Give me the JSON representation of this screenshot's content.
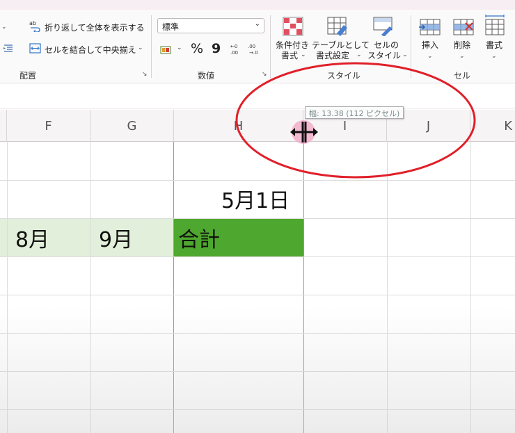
{
  "ribbon": {
    "alignment": {
      "wrap_text_label": "折り返して全体を表示する",
      "merge_center_label": "セルを結合して中央揃え",
      "group_label": "配置"
    },
    "number": {
      "format_value": "標準",
      "percent_symbol": "%",
      "comma_symbol": "9",
      "group_label": "数値"
    },
    "styles": {
      "conditional_line1": "条件付き",
      "conditional_line2": "書式",
      "table_line1": "テーブルとして",
      "table_line2": "書式設定",
      "cell_styles_line1": "セルの",
      "cell_styles_line2": "スタイル",
      "group_label": "スタイル"
    },
    "cells": {
      "insert_label": "挿入",
      "delete_label": "削除",
      "format_label": "書式",
      "group_label": "セル"
    }
  },
  "sheet": {
    "columns": [
      "F",
      "G",
      "H",
      "I",
      "J",
      "K"
    ],
    "date_cell": "5月1日",
    "header_cells": [
      "8月",
      "9月",
      "合計"
    ]
  },
  "tooltip": {
    "text": "幅: 13.38 (112 ピクセル)"
  },
  "colors": {
    "light_green_fill": "#e2efda",
    "dark_green_fill": "#4ea72e",
    "annotation_red": "#e0202a"
  }
}
